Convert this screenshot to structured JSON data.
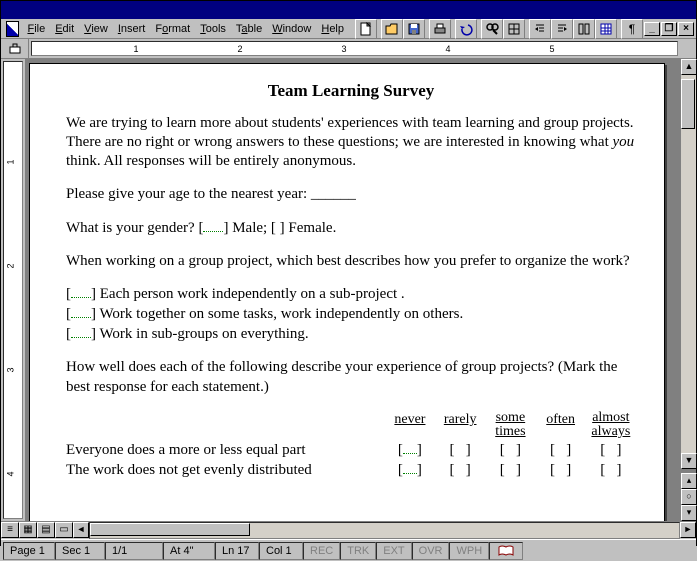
{
  "menus": {
    "file": "File",
    "edit": "Edit",
    "view": "View",
    "insert": "Insert",
    "format": "Format",
    "tools": "Tools",
    "table": "Table",
    "window": "Window",
    "help": "Help"
  },
  "ruler": {
    "h": [
      "1",
      "2",
      "3",
      "4",
      "5"
    ],
    "v": [
      "1",
      "2",
      "3",
      "4"
    ]
  },
  "doc": {
    "title": "Team Learning Survey",
    "intro": "We are trying to learn more about students' experiences with team learning and group projects.  There are no right or wrong answers to these questions; we are interested in knowing what ",
    "intro_em": "you",
    "intro2": " think.   All responses will be entirely anonymous.",
    "age_q": "Please give your age to the nearest year:  ______",
    "gender_pre": "What is your gender?   [",
    "gender_male": "]  Male;      [     ]  Female.",
    "org_q": "When working on a group project, which best describes how you prefer to organize the work?",
    "opt1": "]  Each person work independently on a sub-project .",
    "opt2": "]  Work together on some tasks, work independently on others.",
    "opt3": "]  Work in sub-groups on everything.",
    "rate_q": "How well does each of the following describe your experience of group projects?  (Mark the best response for each statement.)",
    "cols": {
      "c1": "never",
      "c2": "rarely",
      "c3a": "some",
      "c3b": "times",
      "c4": "often",
      "c5a": "almost",
      "c5b": "always"
    },
    "row1": "Everyone does a more or less equal part",
    "row2": "The work does not get evenly distributed",
    "box_open": "[",
    "box_close": "]"
  },
  "status": {
    "page": "Page 1",
    "sec": "Sec 1",
    "pages": "1/1",
    "at": "At 4\"",
    "ln": "Ln 17",
    "col": "Col 1",
    "rec": "REC",
    "trk": "TRK",
    "ext": "EXT",
    "ovr": "OVR",
    "wph": "WPH"
  }
}
